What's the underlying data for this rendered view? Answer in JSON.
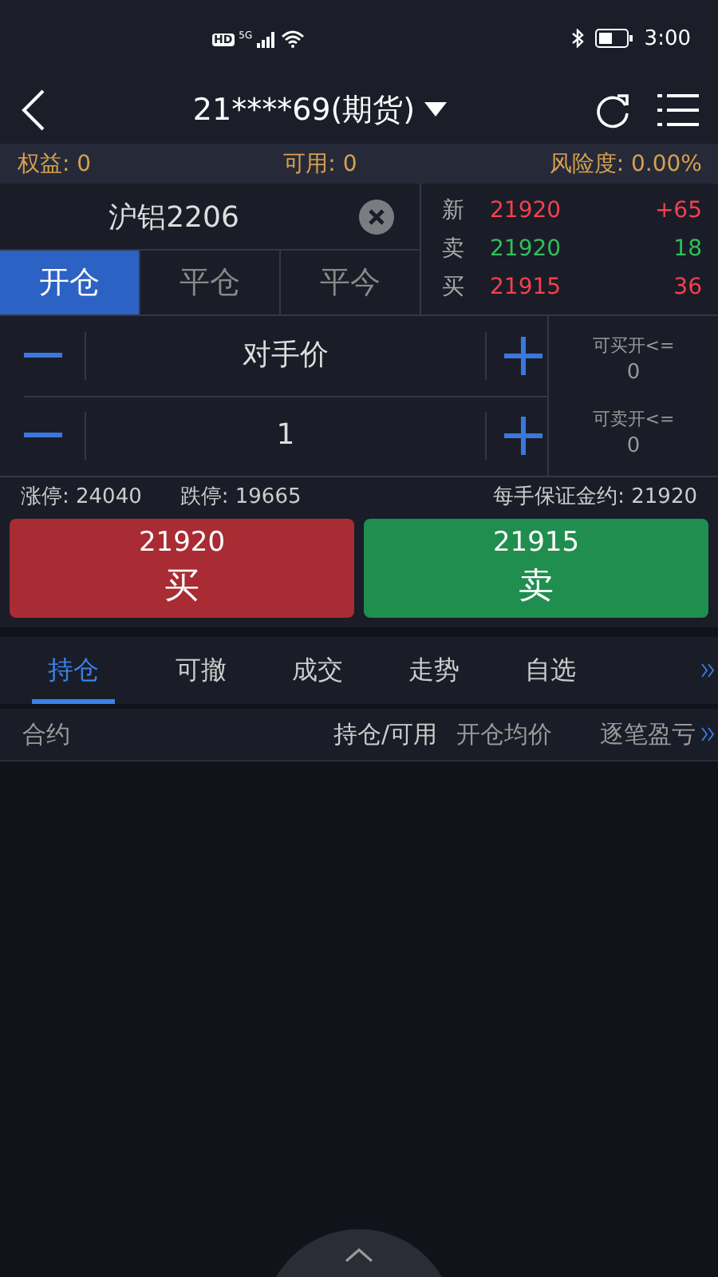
{
  "status_bar": {
    "hd": "HD",
    "network": "5G",
    "time": "3:00"
  },
  "header": {
    "title": "21****69(期货)"
  },
  "account": [
    {
      "text": "权益: 0"
    },
    {
      "text": "可用: 0"
    },
    {
      "text": "风险度:  0.00%"
    }
  ],
  "symbol": {
    "value": "沪铝2206"
  },
  "order_tabs": [
    {
      "label": "开仓",
      "selected": true
    },
    {
      "label": "平仓",
      "selected": false
    },
    {
      "label": "平今",
      "selected": false
    }
  ],
  "quotes": [
    {
      "label": "新",
      "price": "21920",
      "amount": "+65",
      "color": "#f5404e"
    },
    {
      "label": "卖",
      "price": "21920",
      "amount": "18",
      "color": "#2fc05a"
    },
    {
      "label": "买",
      "price": "21915",
      "amount": "36",
      "color": "#f5404e"
    }
  ],
  "steppers": [
    {
      "value": "对手价"
    },
    {
      "value": "1"
    }
  ],
  "capacity": [
    {
      "label": "可买开<=",
      "value": "0"
    },
    {
      "label": "可卖开<=",
      "value": "0"
    }
  ],
  "limits": {
    "up": "涨停: 24040",
    "down": "跌停: 19665",
    "margin": "每手保证金约: 21920"
  },
  "actions": [
    {
      "kind": "buy",
      "price": "21920",
      "label": "买"
    },
    {
      "kind": "sell",
      "price": "21915",
      "label": "卖"
    }
  ],
  "bottom_tabs": [
    {
      "label": "持仓",
      "selected": true
    },
    {
      "label": "可撤",
      "selected": false
    },
    {
      "label": "成交",
      "selected": false
    },
    {
      "label": "走势",
      "selected": false
    },
    {
      "label": "自选",
      "selected": false
    }
  ],
  "table": {
    "columns": [
      "合约",
      "持仓/可用",
      "开仓均价",
      "逐笔盈亏"
    ]
  }
}
